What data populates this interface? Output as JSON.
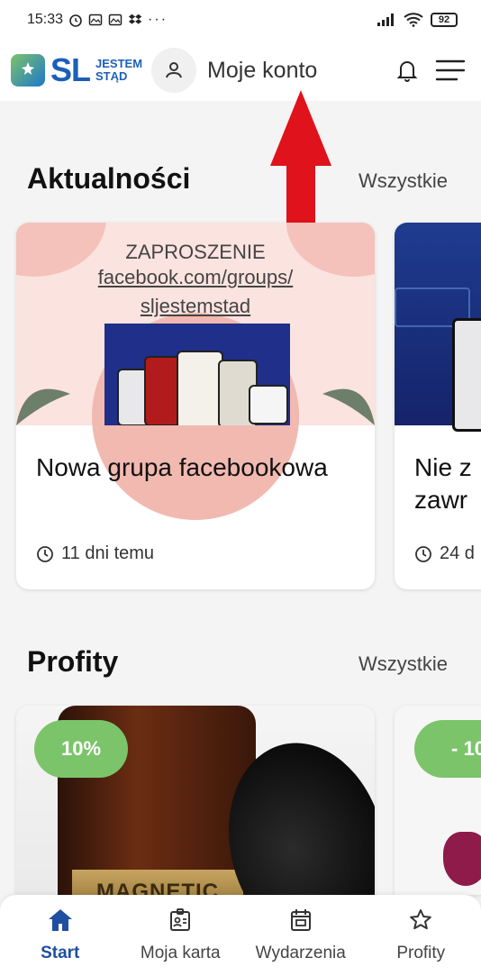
{
  "status_bar": {
    "time": "15:33",
    "icons_left": [
      "alarm-icon",
      "gallery-icon",
      "gallery-icon",
      "dropbox-icon",
      "more-dots-icon"
    ],
    "battery": "92"
  },
  "header": {
    "logo_sl": "SL",
    "logo_line1": "JESTEM",
    "logo_line2": "STĄD",
    "account_label": "Moje konto"
  },
  "news": {
    "title": "Aktualności",
    "see_all": "Wszystkie",
    "items": [
      {
        "invite_heading": "ZAPROSZENIE",
        "invite_link_1": "facebook.com/groups/",
        "invite_link_2": "sljestemstad",
        "title": "Nowa grupa facebookowa",
        "time": "11 dni temu"
      },
      {
        "title": "Nie z zawr",
        "time": "24 d"
      }
    ]
  },
  "profits": {
    "title": "Profity",
    "see_all": "Wszystkie",
    "items": [
      {
        "badge": "10%",
        "label_text": "MAGNETIC"
      },
      {
        "badge": "- 10"
      }
    ]
  },
  "bottom_nav": {
    "items": [
      {
        "label": "Start",
        "icon": "home-icon",
        "active": true
      },
      {
        "label": "Moja karta",
        "icon": "id-card-icon",
        "active": false
      },
      {
        "label": "Wydarzenia",
        "icon": "calendar-icon",
        "active": false
      },
      {
        "label": "Profity",
        "icon": "star-icon",
        "active": false
      }
    ]
  },
  "colors": {
    "brand_blue": "#1c5fb8",
    "active_nav": "#1f4fa0",
    "badge_green": "#7cc46a",
    "arrow_red": "#e0121b"
  }
}
